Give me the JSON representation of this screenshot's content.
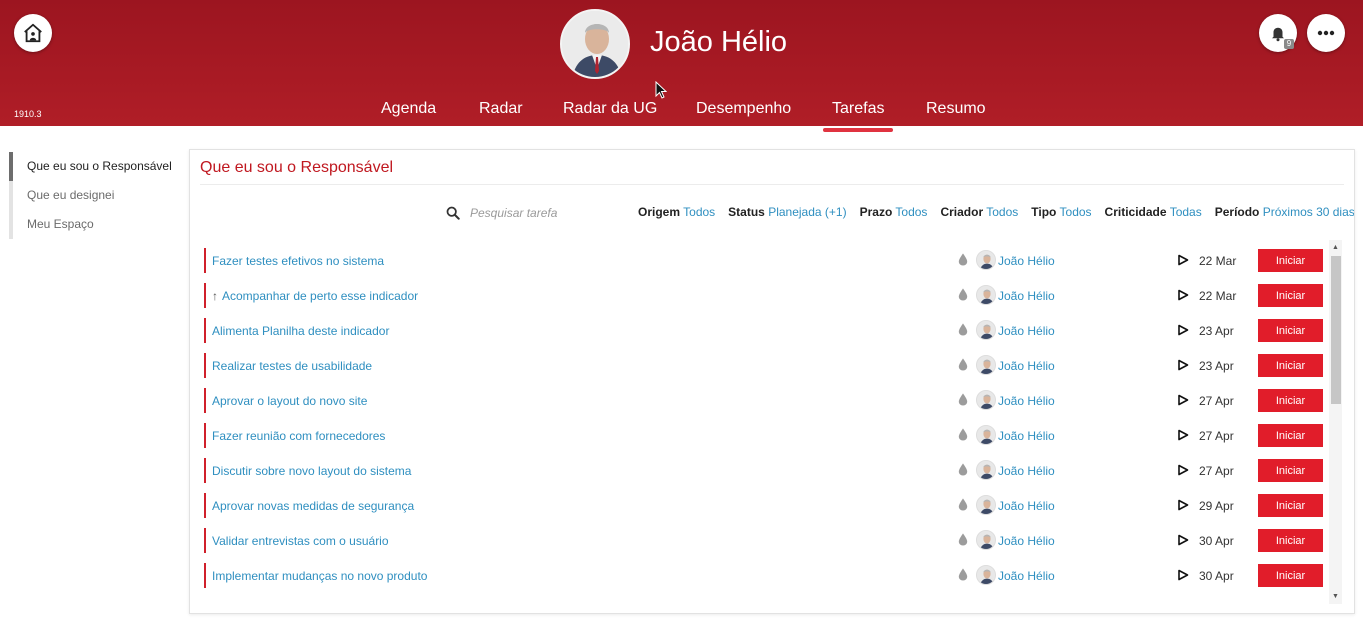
{
  "header": {
    "user_name": "João Hélio",
    "version": "1910.3",
    "notification_count": "9",
    "nav_tabs": [
      {
        "label": "Agenda"
      },
      {
        "label": "Radar"
      },
      {
        "label": "Radar da UG"
      },
      {
        "label": "Desempenho"
      },
      {
        "label": "Tarefas",
        "active": true
      },
      {
        "label": "Resumo"
      }
    ],
    "icons": {
      "home": "home-icon",
      "bell": "bell-icon",
      "more": "more-icon"
    },
    "colors": {
      "header_red": "#a81a24",
      "active_underline": "#e03340"
    }
  },
  "sidebar": {
    "items": [
      {
        "label": "Que eu sou o Responsável",
        "active": true
      },
      {
        "label": "Que eu designei"
      },
      {
        "label": "Meu Espaço"
      }
    ]
  },
  "panel": {
    "title": "Que eu sou o Responsável",
    "search": {
      "placeholder": "Pesquisar tarefa",
      "value": ""
    },
    "filters": [
      {
        "label": "Origem",
        "value": "Todos"
      },
      {
        "label": "Status",
        "value": "Planejada (+1)"
      },
      {
        "label": "Prazo",
        "value": "Todos"
      },
      {
        "label": "Criador",
        "value": "Todos"
      },
      {
        "label": "Tipo",
        "value": "Todos"
      },
      {
        "label": "Criticidade",
        "value": "Todas"
      },
      {
        "label": "Período",
        "value": "Próximos 30 dias"
      }
    ],
    "tasks": [
      {
        "title": "Fazer testes efetivos no sistema",
        "owner": "João Hélio",
        "date": "22 Mar",
        "action": "Iniciar"
      },
      {
        "title": "Acompanhar de perto esse indicador",
        "arrow": "↑",
        "owner": "João Hélio",
        "date": "22 Mar",
        "action": "Iniciar"
      },
      {
        "title": "Alimenta Planilha deste indicador",
        "owner": "João Hélio",
        "date": "23 Apr",
        "action": "Iniciar"
      },
      {
        "title": "Realizar testes de usabilidade",
        "owner": "João Hélio",
        "date": "23 Apr",
        "action": "Iniciar"
      },
      {
        "title": "Aprovar o layout do novo site",
        "owner": "João Hélio",
        "date": "27 Apr",
        "action": "Iniciar"
      },
      {
        "title": "Fazer reunião com fornecedores",
        "owner": "João Hélio",
        "date": "27 Apr",
        "action": "Iniciar"
      },
      {
        "title": "Discutir sobre novo layout do sistema",
        "owner": "João Hélio",
        "date": "27 Apr",
        "action": "Iniciar"
      },
      {
        "title": "Aprovar novas medidas de segurança",
        "owner": "João Hélio",
        "date": "29 Apr",
        "action": "Iniciar"
      },
      {
        "title": "Validar entrevistas com o usuário",
        "owner": "João Hélio",
        "date": "30 Apr",
        "action": "Iniciar"
      },
      {
        "title": "Implementar mudanças no novo produto",
        "owner": "João Hélio",
        "date": "30 Apr",
        "action": "Iniciar"
      }
    ],
    "colors": {
      "title_red": "#c01820",
      "link_blue": "#2f8fc0",
      "button_red": "#e11d2a"
    }
  }
}
